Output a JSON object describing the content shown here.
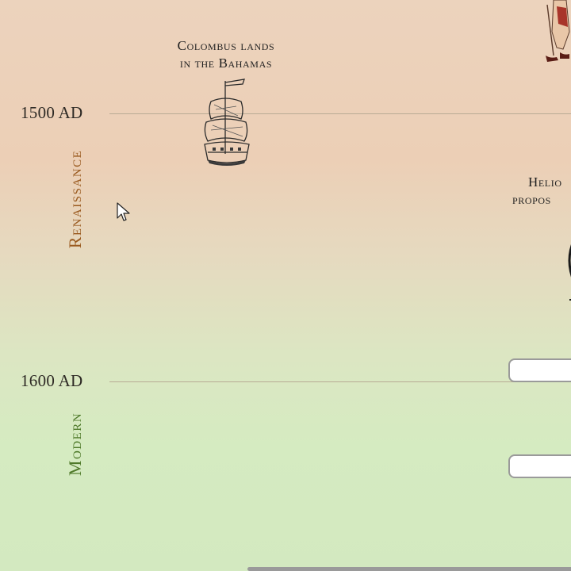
{
  "timeline": {
    "years": [
      "1500 AD",
      "1600 AD"
    ],
    "eras": [
      {
        "label": "Renaissance",
        "color": "#9a5a1f"
      },
      {
        "label": "Modern",
        "color": "#4f7a2a"
      }
    ],
    "events": [
      {
        "lines": [
          "Colombus lands",
          "in the Bahamas"
        ],
        "icon": "ship-icon"
      },
      {
        "lines": [
          "Helio",
          "propos"
        ],
        "icon": "globe-icon"
      }
    ]
  },
  "icons": {
    "ship": "ship-icon",
    "cursor": "mouse-cursor-icon",
    "explorer": "explorer-figure-icon",
    "globe": "globe-icon"
  }
}
